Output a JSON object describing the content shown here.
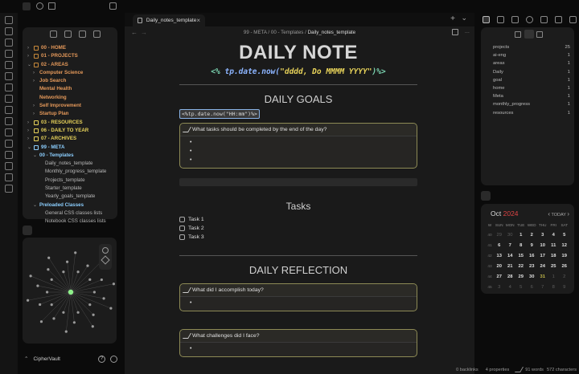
{
  "window": {
    "title": "Daily_notes_template"
  },
  "editor": {
    "tab_label": "Daily_notes_template",
    "tab_close": "×",
    "new_tab": "+",
    "tab_menu": "⌄",
    "nav_back": "←",
    "nav_forward": "→",
    "breadcrumb": {
      "part1": "99 - META",
      "sep1": "/",
      "part2": "00 - Templates",
      "sep2": "/",
      "current": "Daily_notes_template"
    },
    "more": "···"
  },
  "explorer": {
    "items": [
      {
        "label": "00 - HOME",
        "level": 0,
        "chev": "›",
        "color": "orange"
      },
      {
        "label": "01 - PROJECTS",
        "level": 0,
        "chev": "›",
        "color": "orange"
      },
      {
        "label": "02 - AREAS",
        "level": 0,
        "chev": "⌄",
        "color": "orange"
      },
      {
        "label": "Computer Science",
        "level": 1,
        "chev": "›",
        "color": "orange"
      },
      {
        "label": "Job Search",
        "level": 1,
        "chev": "›",
        "color": "orange"
      },
      {
        "label": "Mental Health",
        "level": 1,
        "chev": "",
        "color": "orange"
      },
      {
        "label": "Networking",
        "level": 1,
        "chev": "",
        "color": "orange"
      },
      {
        "label": "Self Improvement",
        "level": 1,
        "chev": "›",
        "color": "orange"
      },
      {
        "label": "Startup Plan",
        "level": 1,
        "chev": "›",
        "color": "orange"
      },
      {
        "label": "03 - RESOURCES",
        "level": 0,
        "chev": "›",
        "color": "yellow"
      },
      {
        "label": "06 - DAILY TO YEAR",
        "level": 0,
        "chev": "›",
        "color": "yellow"
      },
      {
        "label": "07 - ARCHIVES",
        "level": 0,
        "chev": "›",
        "color": "yellow"
      },
      {
        "label": "99 - META",
        "level": 0,
        "chev": "⌄",
        "color": "lblue"
      },
      {
        "label": "00 - Templates",
        "level": 1,
        "chev": "⌄",
        "color": "lblue"
      },
      {
        "label": "Daily_notes_template",
        "level": 2,
        "chev": "",
        "color": "muted"
      },
      {
        "label": "Monthly_progress_template",
        "level": 2,
        "chev": "",
        "color": "muted"
      },
      {
        "label": "Projects_template",
        "level": 2,
        "chev": "",
        "color": "muted"
      },
      {
        "label": "Starter_template",
        "level": 2,
        "chev": "",
        "color": "muted"
      },
      {
        "label": "Yearly_goals_template",
        "level": 2,
        "chev": "",
        "color": "muted"
      },
      {
        "label": "Preloaded Classes",
        "level": 1,
        "chev": "⌄",
        "color": "lblue"
      },
      {
        "label": "General CSS classes lists",
        "level": 2,
        "chev": "",
        "color": "muted"
      },
      {
        "label": "Notebook CSS classes lists",
        "level": 2,
        "chev": "",
        "color": "muted"
      }
    ]
  },
  "vault": {
    "name": "CipherVault",
    "help": "?",
    "chevron": "⌃"
  },
  "note": {
    "title": "DAILY NOTE",
    "date_template": {
      "open": "<%",
      "fn": "tp.date.now(",
      "arg": "\"dddd, Do MMMM YYYY\"",
      "close": ")%>"
    },
    "goals_heading": "DAILY GOALS",
    "time_template": "<%tp.date.now(\"HH:mm\")%>",
    "goals_callout": "What tasks should be completed by the end of the day?",
    "goals_bullets": [
      "",
      "",
      ""
    ],
    "tasks_heading": "Tasks",
    "tasks": [
      "Task 1",
      "Task 2",
      "Task 3"
    ],
    "reflection_heading": "DAILY REFLECTION",
    "accomplish_callout": "What did I accomplish today?",
    "challenges_callout": "What challenges did I face?"
  },
  "tags": {
    "items": [
      {
        "name": "projects",
        "count": "25"
      },
      {
        "name": "ai-eng",
        "count": "1"
      },
      {
        "name": "areas",
        "count": "1"
      },
      {
        "name": "Daily",
        "count": "1"
      },
      {
        "name": "goal",
        "count": "1"
      },
      {
        "name": "home",
        "count": "1"
      },
      {
        "name": "Meta",
        "count": "1"
      },
      {
        "name": "monthly_progress",
        "count": "1"
      },
      {
        "name": "resources",
        "count": "1"
      }
    ]
  },
  "calendar": {
    "month": "Oct",
    "year": "2024",
    "prev": "‹",
    "today": "TODAY",
    "next": "›",
    "weekday_header": [
      "W",
      "SUN",
      "MON",
      "TUE",
      "WED",
      "THU",
      "FRI",
      "SAT"
    ],
    "weeks": [
      {
        "wk": "40",
        "days": [
          "29",
          "30",
          "1",
          "2",
          "3",
          "4",
          "5"
        ],
        "other": [
          true,
          true,
          false,
          false,
          false,
          false,
          false
        ]
      },
      {
        "wk": "41",
        "days": [
          "6",
          "7",
          "8",
          "9",
          "10",
          "11",
          "12"
        ],
        "other": [
          false,
          false,
          false,
          false,
          false,
          false,
          false
        ]
      },
      {
        "wk": "42",
        "days": [
          "13",
          "14",
          "15",
          "16",
          "17",
          "18",
          "19"
        ],
        "other": [
          false,
          false,
          false,
          false,
          false,
          false,
          false
        ]
      },
      {
        "wk": "43",
        "days": [
          "20",
          "21",
          "22",
          "23",
          "24",
          "25",
          "26"
        ],
        "other": [
          false,
          false,
          false,
          false,
          false,
          false,
          false
        ]
      },
      {
        "wk": "44",
        "days": [
          "27",
          "28",
          "29",
          "30",
          "31",
          "1",
          "2"
        ],
        "other": [
          false,
          false,
          false,
          false,
          false,
          true,
          true
        ]
      },
      {
        "wk": "45",
        "days": [
          "3",
          "4",
          "5",
          "6",
          "7",
          "8",
          "9"
        ],
        "other": [
          true,
          true,
          true,
          true,
          true,
          true,
          true
        ]
      }
    ],
    "today_day": "31"
  },
  "status": {
    "backlinks": "0 backlinks",
    "properties": "4 properties",
    "words": "91 words",
    "characters": "572 characters"
  },
  "colors": {
    "accent": "#8ab4e8",
    "callout_border": "#8d8a55",
    "today": "#c3b94a"
  }
}
